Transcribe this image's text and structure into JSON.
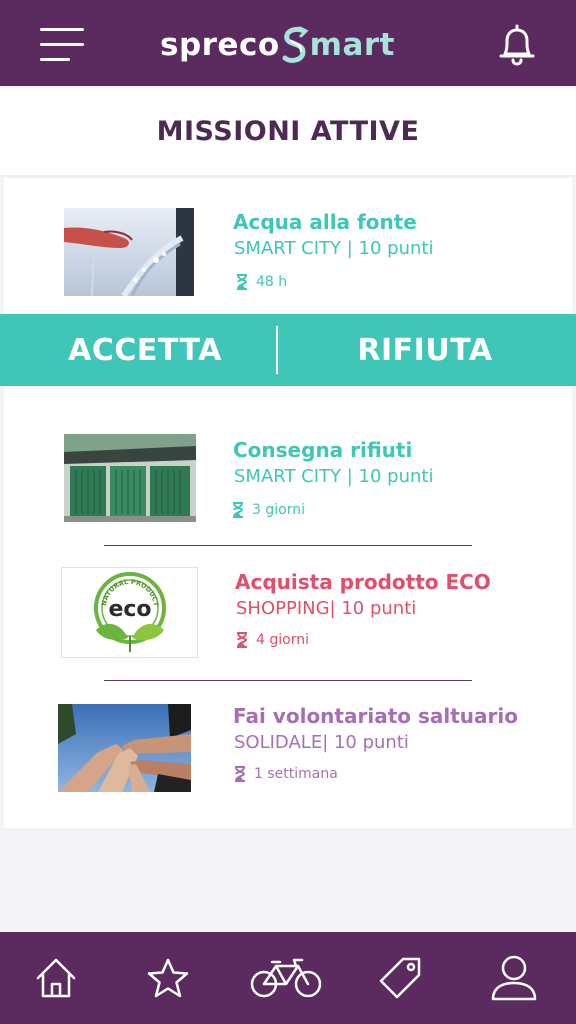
{
  "header": {
    "logo_part1": "spreco",
    "logo_part2": "mart",
    "icons": [
      "menu-icon",
      "bell-icon"
    ]
  },
  "page": {
    "title": "MISSIONI ATTIVE"
  },
  "missions": [
    {
      "name": "Acqua alla fonte",
      "category": "SMART CITY | 10 punti",
      "duration": "48 h",
      "color": "#3fc6b7",
      "image": "water-fountain-photo"
    },
    {
      "name": "Consegna rifiuti",
      "category": "SMART CITY | 10 punti",
      "duration": "3 giorni",
      "color": "#3fc6b7",
      "image": "waste-bins-photo"
    },
    {
      "name": "Acquista prodotto ECO",
      "category": "SHOPPING| 10 punti",
      "duration": "4 giorni",
      "color": "#e04f6c",
      "image": "eco-label-logo"
    },
    {
      "name": "Fai volontariato saltuario",
      "category": "SOLIDALE| 10 punti",
      "duration": "1 settimana",
      "color": "#a66fb5",
      "image": "hands-together-photo"
    }
  ],
  "actions": {
    "accept": "ACCETTA",
    "reject": "RIFIUTA"
  },
  "eco_logo": {
    "word": "eco",
    "ring_text": "NATURAL PRODUCT 100%"
  },
  "nav": {
    "items": [
      "home-icon",
      "star-icon",
      "bicycle-icon",
      "tag-icon",
      "user-icon"
    ]
  },
  "colors": {
    "brand": "#5b2a5e",
    "accent": "#3fc6b7",
    "shopping": "#e04f6c",
    "solidale": "#a66fb5"
  }
}
